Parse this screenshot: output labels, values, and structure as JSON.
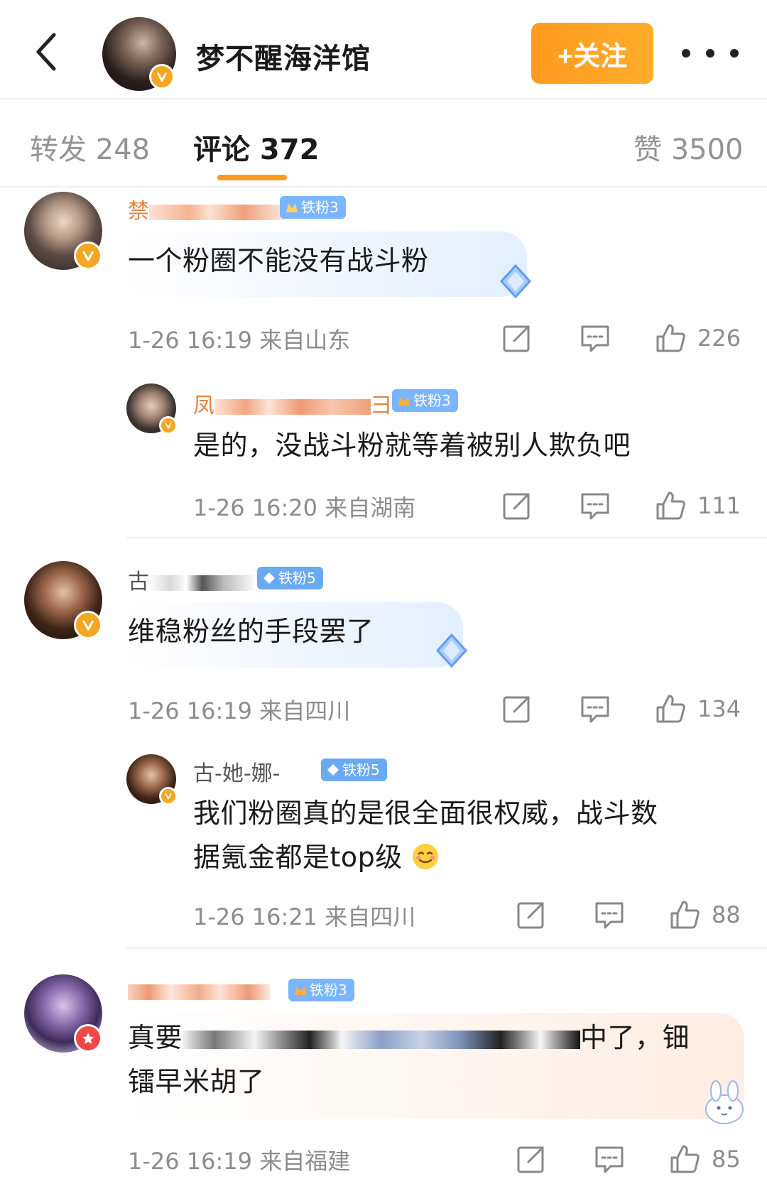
{
  "header": {
    "title": "梦不醒海洋馆",
    "follow_label": "+关注",
    "back_icon": "chevron-left-icon",
    "more_icon": "more-dots-icon",
    "verified_color": "#f5a623"
  },
  "tabs": {
    "repost": "转发 248",
    "comments": "评论 372",
    "likes": "赞 3500",
    "accent": "#ff9a1f"
  },
  "comments": [
    {
      "name_visible": "禁",
      "fan_badge": "铁粉3",
      "text": "一个粉圈不能没有战斗粉",
      "meta": "1-26 16:19 来自山东",
      "likes": "226",
      "replies": [
        {
          "name_visible_start": "凤",
          "name_visible_end": "彐",
          "fan_badge": "铁粉3",
          "text": "是的，没战斗粉就等着被别人欺负吧",
          "meta": "1-26 16:20 来自湖南",
          "likes": "111"
        }
      ]
    },
    {
      "name_visible": "古",
      "fan_badge": "铁粉5",
      "text": "维稳粉丝的手段罢了",
      "meta": "1-26 16:19 来自四川",
      "likes": "134",
      "replies": [
        {
          "name": "古-她-娜-",
          "fan_badge": "铁粉5",
          "text_line1": "我们粉圈真的是很全面很权威，战斗数",
          "text_line2": "据氪金都是top级",
          "meta": "1-26 16:21 来自四川",
          "likes": "88"
        }
      ]
    },
    {
      "fan_badge": "铁粉3",
      "text_start": "真要",
      "text_end": "中了，钿",
      "text_line2": "镭早米胡了",
      "meta": "1-26 16:19 来自福建",
      "likes": "85"
    }
  ]
}
